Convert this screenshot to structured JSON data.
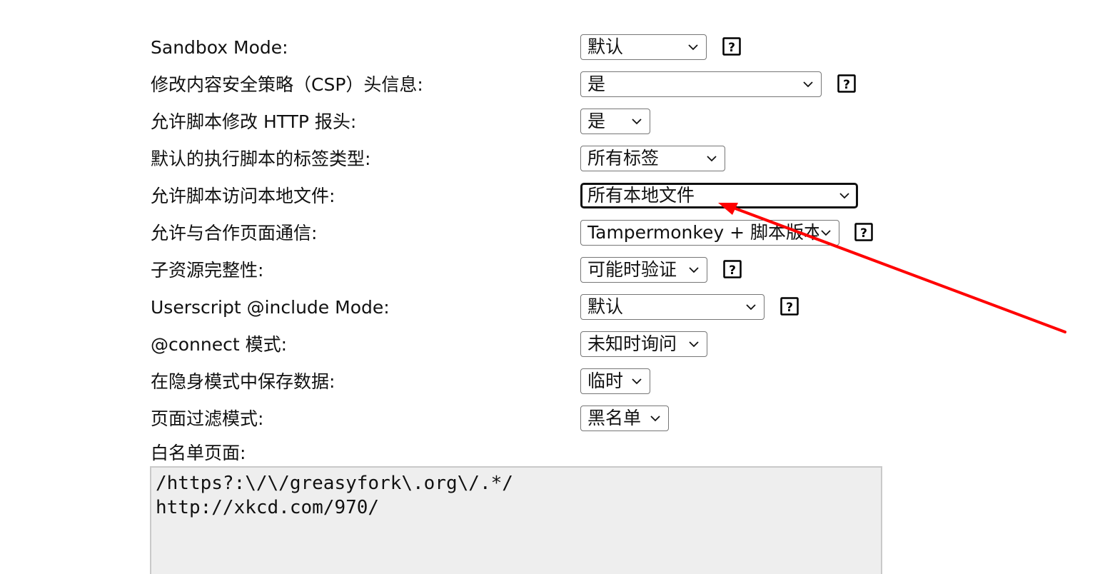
{
  "colors": {
    "annotation_arrow": "#ff0000",
    "textarea_background": "#eeeeee",
    "textarea_border": "#c9c9c9",
    "select_border": "#767676",
    "focused_border": "#101010"
  },
  "icons": {
    "help": "question-mark-in-box",
    "dropdown": "chevron-down"
  },
  "settings": [
    {
      "label": "Sandbox Mode:",
      "value": "默认",
      "help": true
    },
    {
      "label": "修改内容安全策略（CSP）头信息:",
      "value": "是",
      "help": true
    },
    {
      "label": "允许脚本修改 HTTP 报头:",
      "value": "是",
      "help": false
    },
    {
      "label": "默认的执行脚本的标签类型:",
      "value": "所有标签",
      "help": false
    },
    {
      "label": "允许脚本访问本地文件:",
      "value": "所有本地文件",
      "help": false,
      "focused": true
    },
    {
      "label": "允许与合作页面通信:",
      "value": "Tampermonkey + 脚本版本",
      "help": true
    },
    {
      "label": "子资源完整性:",
      "value": "可能时验证",
      "help": true
    },
    {
      "label": "Userscript @include Mode:",
      "value": "默认",
      "help": true
    },
    {
      "label": "@connect 模式:",
      "value": "未知时询问",
      "help": false
    },
    {
      "label": "在隐身模式中保存数据:",
      "value": "临时",
      "help": false
    },
    {
      "label": "页面过滤模式:",
      "value": "黑名单",
      "help": false
    }
  ],
  "whitelist": {
    "label": "白名单页面:",
    "lines": [
      "/https?:\\/\\/greasyfork\\.org\\/.*/",
      "http://xkcd.com/970/"
    ]
  }
}
